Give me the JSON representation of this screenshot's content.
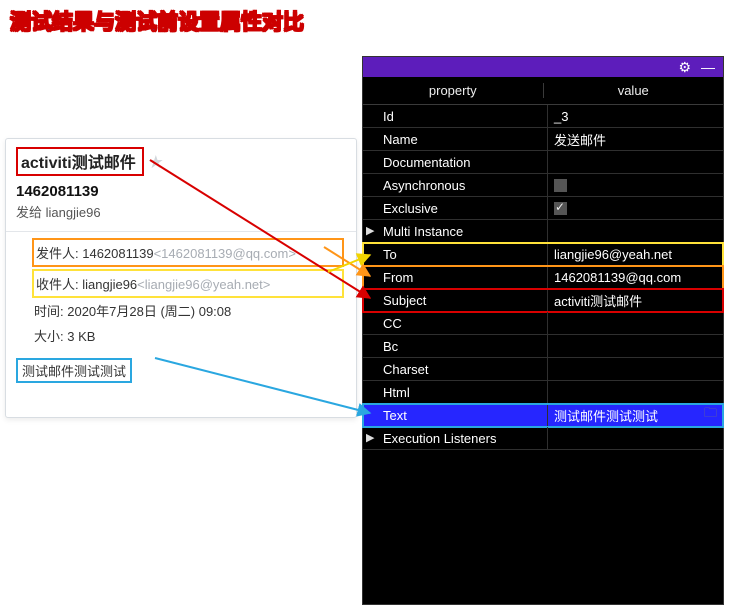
{
  "page_title": "测试结果与测试前设置属性对比",
  "email": {
    "subject": "activiti测试邮件",
    "sender_id": "1462081139",
    "to_prefix": "发给 ",
    "to_name": "liangjie96",
    "from_label": "发件人: ",
    "from_value": "1462081139",
    "from_addr": "<1462081139@qq.com>",
    "recv_label": "收件人: ",
    "recv_value": "liangjie96",
    "recv_addr": "<liangjie96@yeah.net>",
    "time_label": "时间: ",
    "time_value": "2020年7月28日 (周二) 09:08",
    "size_label": "大小: ",
    "size_value": "3 KB",
    "body": "测试邮件测试测试"
  },
  "props": {
    "header_property": "property",
    "header_value": "value",
    "rows": {
      "id_k": "Id",
      "id_v": "_3",
      "name_k": "Name",
      "name_v": "发送邮件",
      "doc_k": "Documentation",
      "async_k": "Asynchronous",
      "excl_k": "Exclusive",
      "multi_k": "Multi Instance",
      "to_k": "To",
      "to_v": "liangjie96@yeah.net",
      "from_k": "From",
      "from_v": "1462081139@qq.com",
      "subj_k": "Subject",
      "subj_v": "activiti测试邮件",
      "cc_k": "CC",
      "bc_k": "Bc",
      "charset_k": "Charset",
      "html_k": "Html",
      "text_k": "Text",
      "text_v": "测试邮件测试测试",
      "exec_k": "Execution Listeners"
    }
  }
}
